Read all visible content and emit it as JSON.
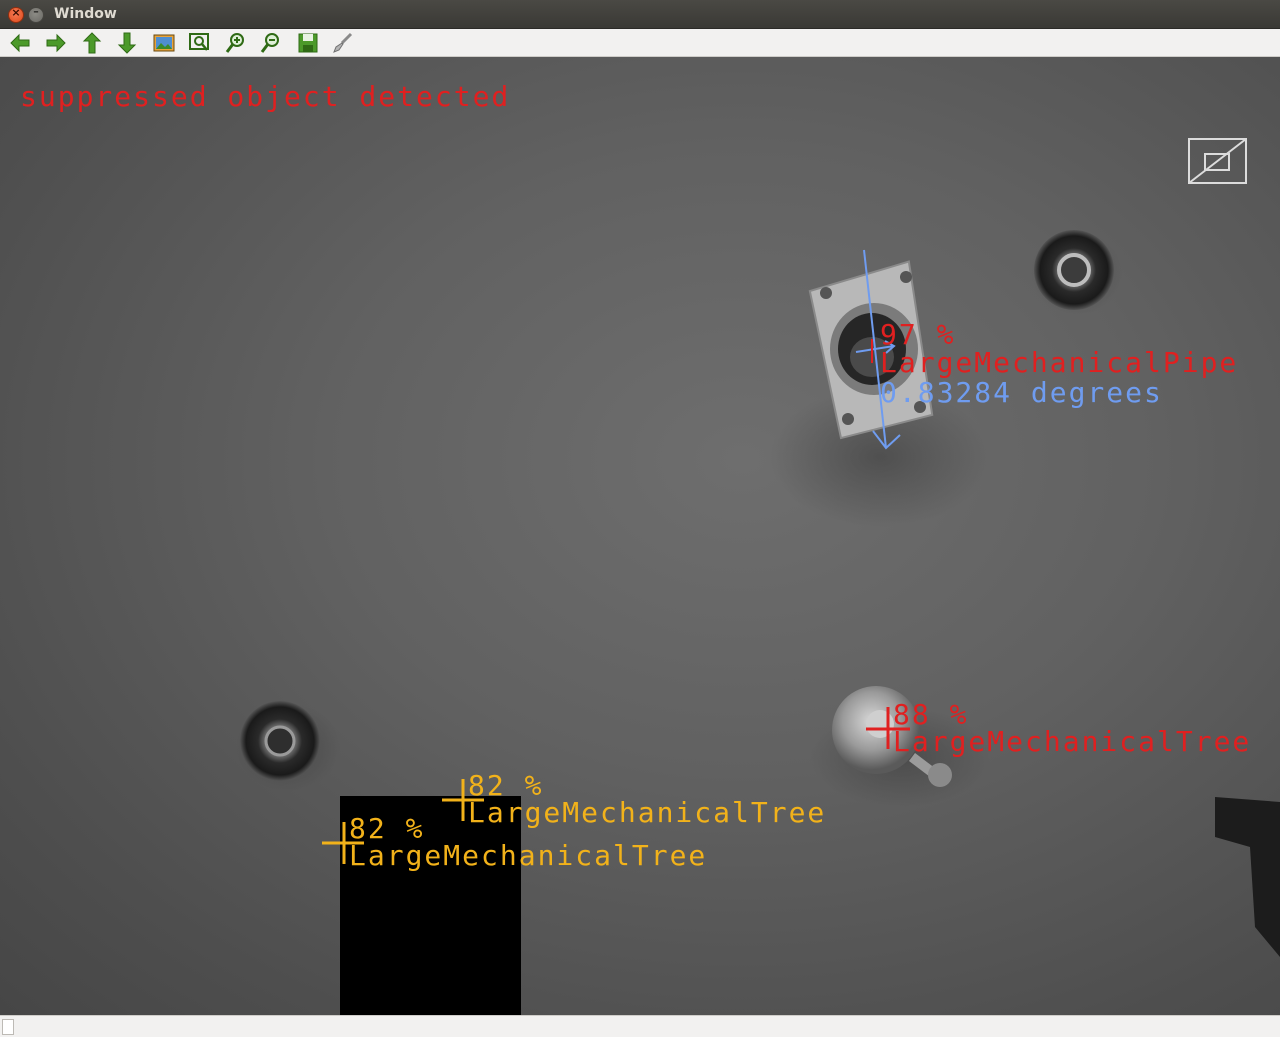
{
  "window": {
    "title": "Window"
  },
  "toolbar": {
    "buttons": [
      {
        "icon": "arrow-left-icon"
      },
      {
        "icon": "arrow-right-icon"
      },
      {
        "icon": "arrow-up-icon"
      },
      {
        "icon": "arrow-down-icon"
      },
      {
        "icon": "image-icon"
      },
      {
        "icon": "zoom-fit-icon"
      },
      {
        "icon": "zoom-in-icon"
      },
      {
        "icon": "zoom-out-icon"
      },
      {
        "icon": "save-icon"
      },
      {
        "icon": "brush-icon"
      }
    ]
  },
  "overlay": {
    "status_text": "suppressed object detected",
    "pipe": {
      "confidence": "97 %",
      "label": "LargeMechanicalPipe",
      "angle": "0.83284 degrees"
    },
    "tree_right": {
      "confidence": "88 %",
      "label": "LargeMechanicalTree"
    },
    "tree_mid": {
      "confidence": "82 %",
      "label": "LargeMechanicalTree"
    },
    "tree_left": {
      "confidence": "82 %",
      "label": "LargeMechanicalTree"
    }
  },
  "colors": {
    "status": "#e02020",
    "detection_red": "#e02020",
    "angle_blue": "#6f9cf0",
    "detection_yellow": "#f2b21a",
    "toolbar_icon_green": "#4c9a2a"
  }
}
